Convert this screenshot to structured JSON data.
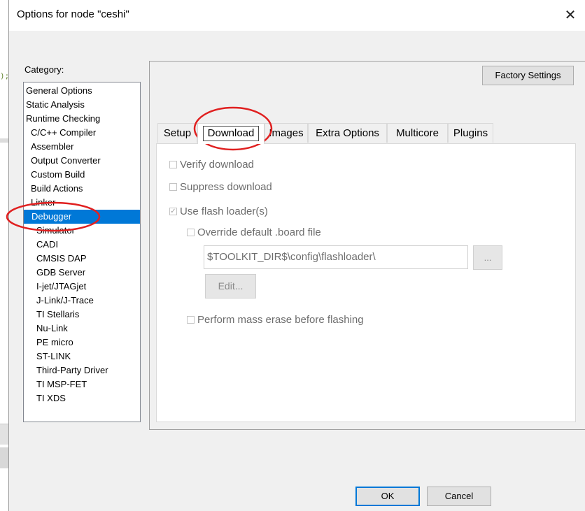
{
  "window": {
    "title": "Options for node \"ceshi\"",
    "close_glyph": "✕"
  },
  "background_editor": {
    "code_fragment": ");"
  },
  "category": {
    "label": "Category:",
    "selected": "Debugger",
    "items": [
      {
        "label": "General Options",
        "level": 0
      },
      {
        "label": "Static Analysis",
        "level": 0
      },
      {
        "label": "Runtime Checking",
        "level": 0
      },
      {
        "label": "C/C++ Compiler",
        "level": 1
      },
      {
        "label": "Assembler",
        "level": 1
      },
      {
        "label": "Output Converter",
        "level": 1
      },
      {
        "label": "Custom Build",
        "level": 1
      },
      {
        "label": "Build Actions",
        "level": 1
      },
      {
        "label": "Linker",
        "level": 1
      },
      {
        "label": "Debugger",
        "level": 1
      },
      {
        "label": "Simulator",
        "level": 2
      },
      {
        "label": "CADI",
        "level": 2
      },
      {
        "label": "CMSIS DAP",
        "level": 2
      },
      {
        "label": "GDB Server",
        "level": 2
      },
      {
        "label": "I-jet/JTAGjet",
        "level": 2
      },
      {
        "label": "J-Link/J-Trace",
        "level": 2
      },
      {
        "label": "TI Stellaris",
        "level": 2
      },
      {
        "label": "Nu-Link",
        "level": 2
      },
      {
        "label": "PE micro",
        "level": 2
      },
      {
        "label": "ST-LINK",
        "level": 2
      },
      {
        "label": "Third-Party Driver",
        "level": 2
      },
      {
        "label": "TI MSP-FET",
        "level": 2
      },
      {
        "label": "TI XDS",
        "level": 2
      }
    ]
  },
  "factory_settings_label": "Factory Settings",
  "tabs": [
    {
      "label": "Setup",
      "active": false
    },
    {
      "label": "Download",
      "active": true
    },
    {
      "label": "Images",
      "active": false
    },
    {
      "label": "Extra Options",
      "active": false
    },
    {
      "label": "Multicore",
      "active": false
    },
    {
      "label": "Plugins",
      "active": false
    }
  ],
  "download": {
    "verify_download": {
      "label": "Verify download",
      "checked": false,
      "enabled": false
    },
    "suppress_download": {
      "label": "Suppress download",
      "checked": false,
      "enabled": false
    },
    "use_flash_loaders": {
      "label": "Use flash loader(s)",
      "checked": true,
      "enabled": false
    },
    "override_board_file": {
      "label": "Override default .board file",
      "checked": false,
      "enabled": false
    },
    "board_file_path": "$TOOLKIT_DIR$\\config\\flashloader\\",
    "browse_label": "...",
    "edit_label": "Edit...",
    "mass_erase": {
      "label": "Perform mass erase before flashing",
      "checked": false,
      "enabled": false
    }
  },
  "buttons": {
    "ok": "OK",
    "cancel": "Cancel"
  },
  "colors": {
    "selection": "#0078d7",
    "annotation_red": "#e02020"
  }
}
